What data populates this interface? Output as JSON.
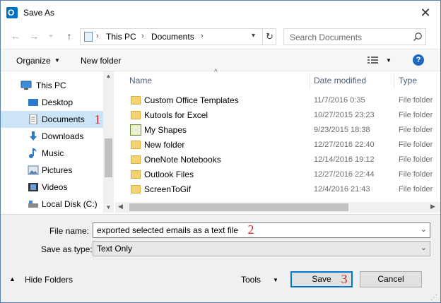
{
  "window": {
    "title": "Save As",
    "close_glyph": "✕",
    "app_icon": "outlook-icon"
  },
  "nav": {
    "back": "←",
    "forward": "→",
    "history": "⌄",
    "up": "↑",
    "crumbs": [
      "This PC",
      "Documents"
    ],
    "crumb_separator": "›",
    "refresh": "↻",
    "search_placeholder": "Search Documents"
  },
  "toolbar": {
    "organize": "Organize",
    "new_folder": "New folder",
    "help": "?"
  },
  "sidebar": {
    "items": [
      {
        "label": "This PC",
        "icon": "computer-icon",
        "selected": false
      },
      {
        "label": "Desktop",
        "icon": "desktop-icon",
        "selected": false
      },
      {
        "label": "Documents",
        "icon": "documents-icon",
        "selected": true
      },
      {
        "label": "Downloads",
        "icon": "downloads-icon",
        "selected": false
      },
      {
        "label": "Music",
        "icon": "music-icon",
        "selected": false
      },
      {
        "label": "Pictures",
        "icon": "pictures-icon",
        "selected": false
      },
      {
        "label": "Videos",
        "icon": "videos-icon",
        "selected": false
      },
      {
        "label": "Local Disk (C:)",
        "icon": "disk-icon",
        "selected": false
      }
    ]
  },
  "files": {
    "columns": {
      "name": "Name",
      "date": "Date modified",
      "type": "Type"
    },
    "rows": [
      {
        "name": "Custom Office Templates",
        "date": "11/7/2016 0:35",
        "type": "File folder",
        "icon": "folder-icon"
      },
      {
        "name": "Kutools for Excel",
        "date": "10/27/2015 23:23",
        "type": "File folder",
        "icon": "folder-icon"
      },
      {
        "name": "My Shapes",
        "date": "9/23/2015 18:38",
        "type": "File folder",
        "icon": "shapes-folder-icon"
      },
      {
        "name": "New folder",
        "date": "12/27/2016 22:40",
        "type": "File folder",
        "icon": "folder-icon"
      },
      {
        "name": "OneNote Notebooks",
        "date": "12/14/2016 19:12",
        "type": "File folder",
        "icon": "folder-icon"
      },
      {
        "name": "Outlook Files",
        "date": "12/27/2016 22:44",
        "type": "File folder",
        "icon": "folder-icon"
      },
      {
        "name": "ScreenToGif",
        "date": "12/4/2016 21:43",
        "type": "File folder",
        "icon": "folder-icon"
      }
    ]
  },
  "form": {
    "file_name_label": "File name:",
    "file_name_value": "exported selected emails as a text file",
    "save_type_label": "Save as type:",
    "save_type_value": "Text Only"
  },
  "footer": {
    "hide_folders": "Hide Folders",
    "tools": "Tools",
    "save": "Save",
    "cancel": "Cancel"
  },
  "annotations": [
    "1",
    "2",
    "3"
  ],
  "colors": {
    "selection": "#cce4f7",
    "accent": "#0078d7",
    "annotation": "#e02020"
  }
}
